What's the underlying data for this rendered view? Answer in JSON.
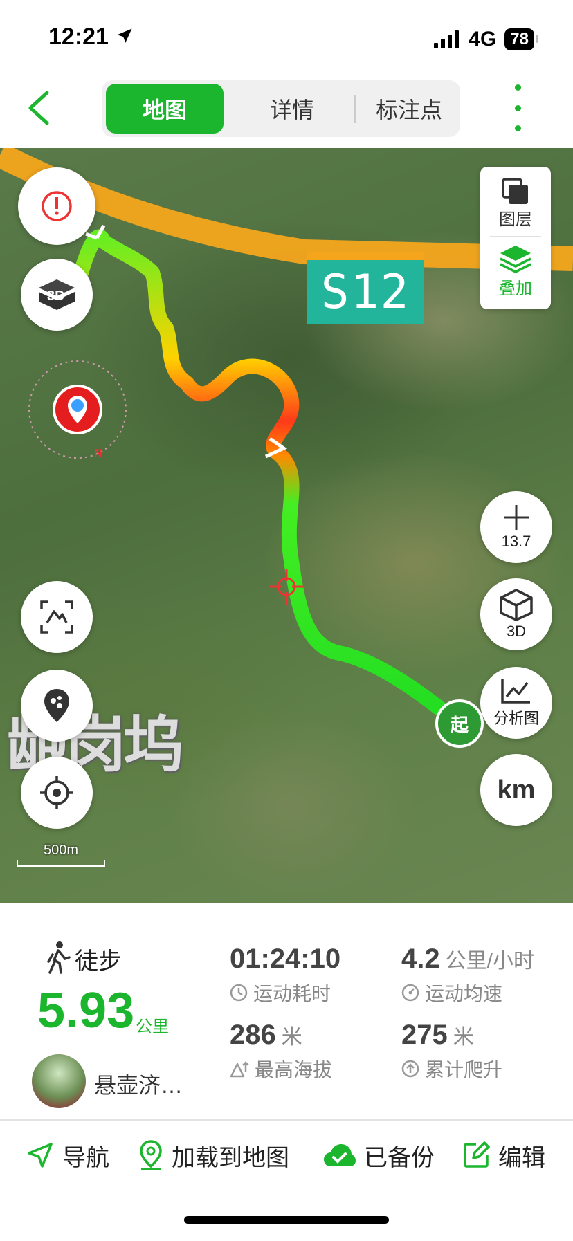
{
  "status_bar": {
    "time": "12:21",
    "network": "4G",
    "battery": "78"
  },
  "header": {
    "tabs": [
      {
        "label": "地图",
        "active": true
      },
      {
        "label": "详情",
        "active": false
      },
      {
        "label": "标注点",
        "active": false
      }
    ]
  },
  "map": {
    "road_label": "S12",
    "place_label": "龅岗坞",
    "scale_label": "500m",
    "zoom_level": "13.7",
    "layers_label": "图层",
    "overlay_label": "叠加",
    "btn_3d_label": "3D",
    "analysis_label": "分析图",
    "unit_toggle": "km",
    "start_label": "起",
    "icons": [
      "warning-icon",
      "3d-view-icon",
      "zoom-in-icon",
      "cube-3d-icon",
      "chart-icon",
      "fit-track-icon",
      "footprint-icon",
      "locate-icon"
    ]
  },
  "track": {
    "activity": "徒步",
    "distance": "5.93",
    "distance_unit": "公里",
    "user": "悬壶济…",
    "stats": [
      {
        "value": "01:24:10",
        "unit": "",
        "label": "运动耗时",
        "icon": "clock-icon"
      },
      {
        "value": "4.2",
        "unit": "公里/小时",
        "label": "运动均速",
        "icon": "speed-icon"
      },
      {
        "value": "286",
        "unit": "米",
        "label": "最高海拔",
        "icon": "altitude-icon"
      },
      {
        "value": "275",
        "unit": "米",
        "label": "累计爬升",
        "icon": "climb-icon"
      }
    ]
  },
  "actions": [
    {
      "label": "导航",
      "icon": "navigate-icon"
    },
    {
      "label": "加载到地图",
      "icon": "load-map-icon"
    },
    {
      "label": "已备份",
      "icon": "cloud-check-icon"
    },
    {
      "label": "编辑",
      "icon": "edit-icon"
    }
  ],
  "colors": {
    "accent": "#1cb52e",
    "road": "#f4a51c",
    "road_badge": "#22b59b"
  }
}
